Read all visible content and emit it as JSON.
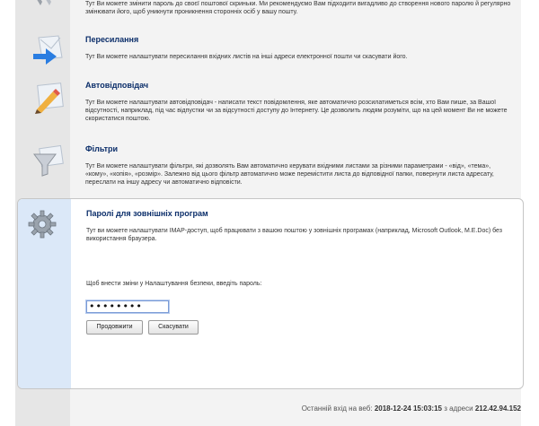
{
  "intro": {
    "description": "Тут Ви можете змінити пароль до своєї поштової скриньки. Ми рекомендуємо Вам підходити вигадливо до створення нового паролю й регулярно змінювати його, щоб уникнути проникнення сторонніх осіб у вашу пошту."
  },
  "sections": [
    {
      "title": "Пересилання",
      "description": "Тут Ви можете налаштувати пересилання вхідних листів на інші адреси електронної пошти чи скасувати його.",
      "icon": "forward-arrow-icon"
    },
    {
      "title": "Автовідповідач",
      "description": "Тут Ви можете налаштувати автовідповідач - написати текст повідомлення, яке автоматично розсилатиметься всім, хто Вам пише, за Вашої відсутності, наприклад, під час відпустки чи за відсутності доступу до Інтернету. Це дозволить людям розуміти, що на цей момент Ви не можете скористатися поштою.",
      "icon": "pencil-icon"
    },
    {
      "title": "Фільтри",
      "description": "Тут Ви можете налаштувати фільтри, які дозволять Вам автоматично керувати вхідними листами за різними параметрами - «від», «тема», «кому», «копія», «розмір». Залежно від цього фільтр автоматично може перемістити листа до відповідної папки, повернути листа адресату, переслати на іншу адресу чи автоматично відповісти.",
      "icon": "funnel-icon"
    }
  ],
  "panel": {
    "title": "Паролі для зовнішніх програм",
    "description": "Тут ви можете налаштувати IMAP-доступ, щоб працювати з вашою поштою у зовнішніх програмах (наприклад, Microsoft Outlook, M.E.Doc) без використання браузера.",
    "prompt": "Щоб внести зміни у Налаштування безпеки, введіть пароль:",
    "password_value": "••••••••",
    "continue_label": "Продовжити",
    "cancel_label": "Скасувати",
    "icon": "gear-icon"
  },
  "footer": {
    "prefix": "Останній вхід на веб:",
    "timestamp": "2018-12-24 15:03:15",
    "middle": "з адреси",
    "ip": "212.42.94.152"
  }
}
